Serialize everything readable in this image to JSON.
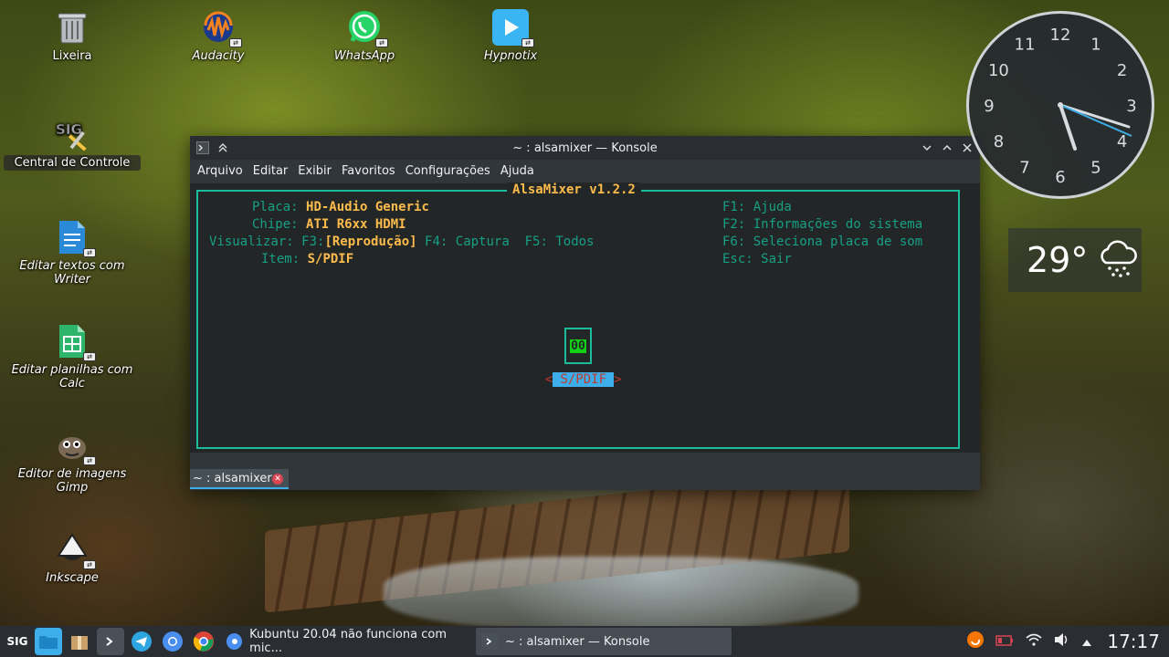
{
  "desktop": {
    "icons": [
      {
        "label": "Lixeira"
      },
      {
        "label": "Audacity"
      },
      {
        "label": "WhatsApp"
      },
      {
        "label": "Hypnotix"
      },
      {
        "label": "Central de Controle"
      },
      {
        "label": "Editar textos com Writer"
      },
      {
        "label": "Editar planilhas com Calc"
      },
      {
        "label": "Editor de imagens Gimp"
      },
      {
        "label": "Inkscape"
      }
    ]
  },
  "window": {
    "title": "~ : alsamixer — Konsole",
    "menu": [
      "Arquivo",
      "Editar",
      "Exibir",
      "Favoritos",
      "Configurações",
      "Ajuda"
    ],
    "tab_label": "~ : alsamixer"
  },
  "alsamixer": {
    "title": "AlsaMixer v1.2.2",
    "card_label": "Placa:",
    "card_value": "HD-Audio Generic",
    "chip_label": "Chipe:",
    "chip_value": "ATI R6xx HDMI",
    "view_label": "Visualizar:",
    "view_f3": "F3:",
    "view_f3_value": "[Reprodução]",
    "view_f4": "F4: Captura",
    "view_f5": "F5: Todos",
    "item_label": "Item:",
    "item_value": "S/PDIF",
    "help_f1": "F1: Ajuda",
    "help_f2": "F2: Informações do sistema",
    "help_f6": "F6: Seleciona placa de som",
    "help_esc": "Esc: Sair",
    "control_value": "00",
    "control_name": "S/PDIF",
    "arrow_left": "<",
    "arrow_right": ">"
  },
  "clock": {
    "numbers": [
      "12",
      "1",
      "2",
      "3",
      "4",
      "5",
      "6",
      "7",
      "8",
      "9",
      "10",
      "11"
    ]
  },
  "weather": {
    "temperature": "29°",
    "icon": "cloud-rain-icon"
  },
  "taskbar": {
    "tasks": [
      {
        "label": "Kubuntu 20.04 não funciona com mic..."
      },
      {
        "label": "~ : alsamixer — Konsole"
      }
    ],
    "time": "17:17"
  },
  "colors": {
    "accent": "#3daee9",
    "terminal_cyan": "#16a085",
    "terminal_yellow": "#fdbc4b",
    "window_bg": "#31363b"
  }
}
